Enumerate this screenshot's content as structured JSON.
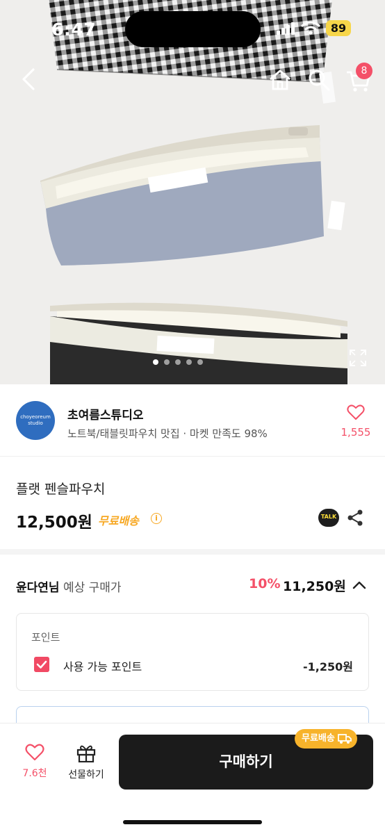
{
  "status_bar": {
    "time": "6:47",
    "battery": "89"
  },
  "nav": {
    "cart_count": "8"
  },
  "gallery": {
    "total_dots": 5,
    "active_dot": 0
  },
  "shop": {
    "avatar_line1": "choyeoreum",
    "avatar_line2": "studio",
    "name": "초여름스튜디오",
    "description": "노트북/태블릿파우치 맛집 · 마켓 만족도 98%",
    "favorite_count": "1,555"
  },
  "product": {
    "title": "플랫 펜슬파우치",
    "price": "12,500원",
    "shipping": "무료배송",
    "talk_label": "TALK"
  },
  "expected": {
    "user": "윤다연님",
    "label": "예상 구매가",
    "discount": "10%",
    "price": "11,250원"
  },
  "points": {
    "label": "포인트",
    "use_label": "사용 가능 포인트",
    "value": "-1,250원"
  },
  "bottom_bar": {
    "like_count": "7.6천",
    "gift_label": "선물하기",
    "buy_label": "구매하기",
    "free_shipping_tag": "무료배송"
  },
  "colors": {
    "accent_red": "#f45068",
    "shipping_orange": "#f7a823",
    "buy_button": "#1b1b1b"
  }
}
